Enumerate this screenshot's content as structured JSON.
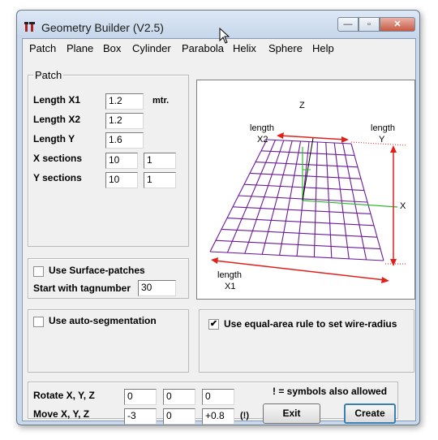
{
  "window": {
    "title": "Geometry Builder (V2.5)",
    "caption_buttons": {
      "minimize": "—",
      "maximize": "▫",
      "close": "✕"
    }
  },
  "menu": [
    "Patch",
    "Plane",
    "Box",
    "Cylinder",
    "Parabola",
    "Helix",
    "Sphere",
    "Help"
  ],
  "patch_group": {
    "title": "Patch",
    "length_x1": {
      "label": "Length X1",
      "value": "1.2",
      "unit": "mtr."
    },
    "length_x2": {
      "label": "Length X2",
      "value": "1.2"
    },
    "length_y": {
      "label": "Length Y",
      "value": "1.6"
    },
    "x_sections": {
      "label": "X sections",
      "value1": "10",
      "value2": "1"
    },
    "y_sections": {
      "label": "Y sections",
      "value1": "10",
      "value2": "1"
    }
  },
  "surface_group": {
    "use_surface_patches": {
      "label": "Use Surface-patches",
      "checked": false
    },
    "start_tag": {
      "label": "Start with tagnumber",
      "value": "30"
    }
  },
  "segmentation_group": {
    "use_auto_segmentation": {
      "label": "Use auto-segmentation",
      "checked": false
    }
  },
  "wire_group": {
    "use_equal_area": {
      "label": "Use equal-area rule to set wire-radius",
      "checked": true,
      "mark": "✔"
    }
  },
  "transform_group": {
    "rotate": {
      "label": "Rotate X, Y, Z",
      "values": [
        "0",
        "0",
        "0"
      ]
    },
    "move": {
      "label": "Move X, Y, Z",
      "values": [
        "-3",
        "0",
        "+0.8"
      ],
      "suffix": "(!)"
    },
    "note": "! =  symbols also allowed",
    "exit_label": "Exit",
    "create_label": "Create"
  },
  "diagram": {
    "axis_z": "Z",
    "axis_x": "X",
    "label_x2_line1": "length",
    "label_x2_line2": "X2",
    "label_y_line1": "length",
    "label_y_line2": "Y",
    "label_x1_line1": "length",
    "label_x1_line2": "X1",
    "colors": {
      "grid": "#6a1b9a",
      "dim": "#e0201b",
      "axis_x": "#2fb82f",
      "axis_y": "#2fb82f"
    }
  }
}
